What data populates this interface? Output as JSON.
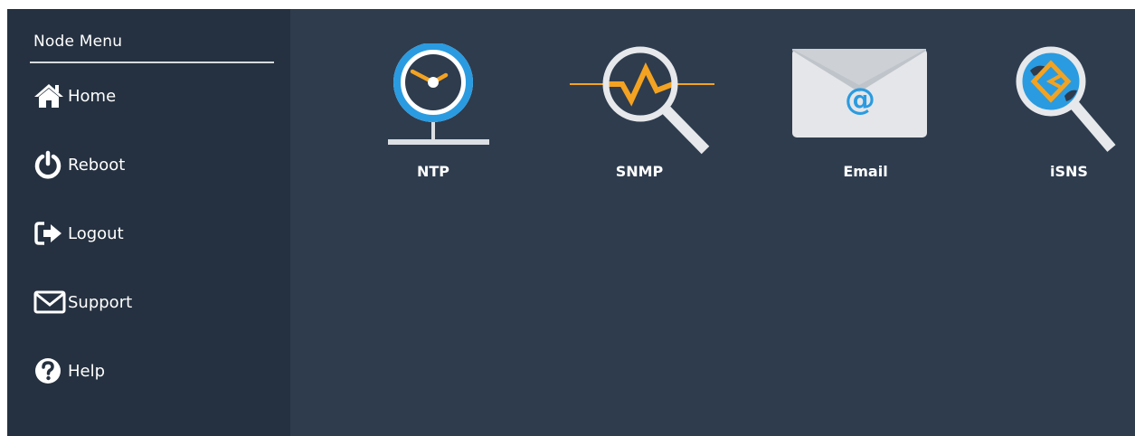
{
  "sidebar": {
    "title": "Node Menu",
    "items": [
      {
        "label": "Home",
        "icon": "home-icon"
      },
      {
        "label": "Reboot",
        "icon": "power-icon"
      },
      {
        "label": "Logout",
        "icon": "logout-icon"
      },
      {
        "label": "Support",
        "icon": "envelope-icon"
      },
      {
        "label": "Help",
        "icon": "question-circle-icon"
      }
    ]
  },
  "tiles": [
    {
      "label": "NTP",
      "icon": "clock-icon"
    },
    {
      "label": "SNMP",
      "icon": "magnifier-signal-icon"
    },
    {
      "label": "Email",
      "icon": "email-envelope-icon"
    },
    {
      "label": "iSNS",
      "icon": "magnifier-isns-icon"
    }
  ],
  "colors": {
    "page_bg": "#2e3c4e",
    "sidebar_bg": "#253140",
    "accent_blue": "#2a9be0",
    "accent_orange": "#f3a321",
    "icon_gray": "#dcdfe3"
  }
}
